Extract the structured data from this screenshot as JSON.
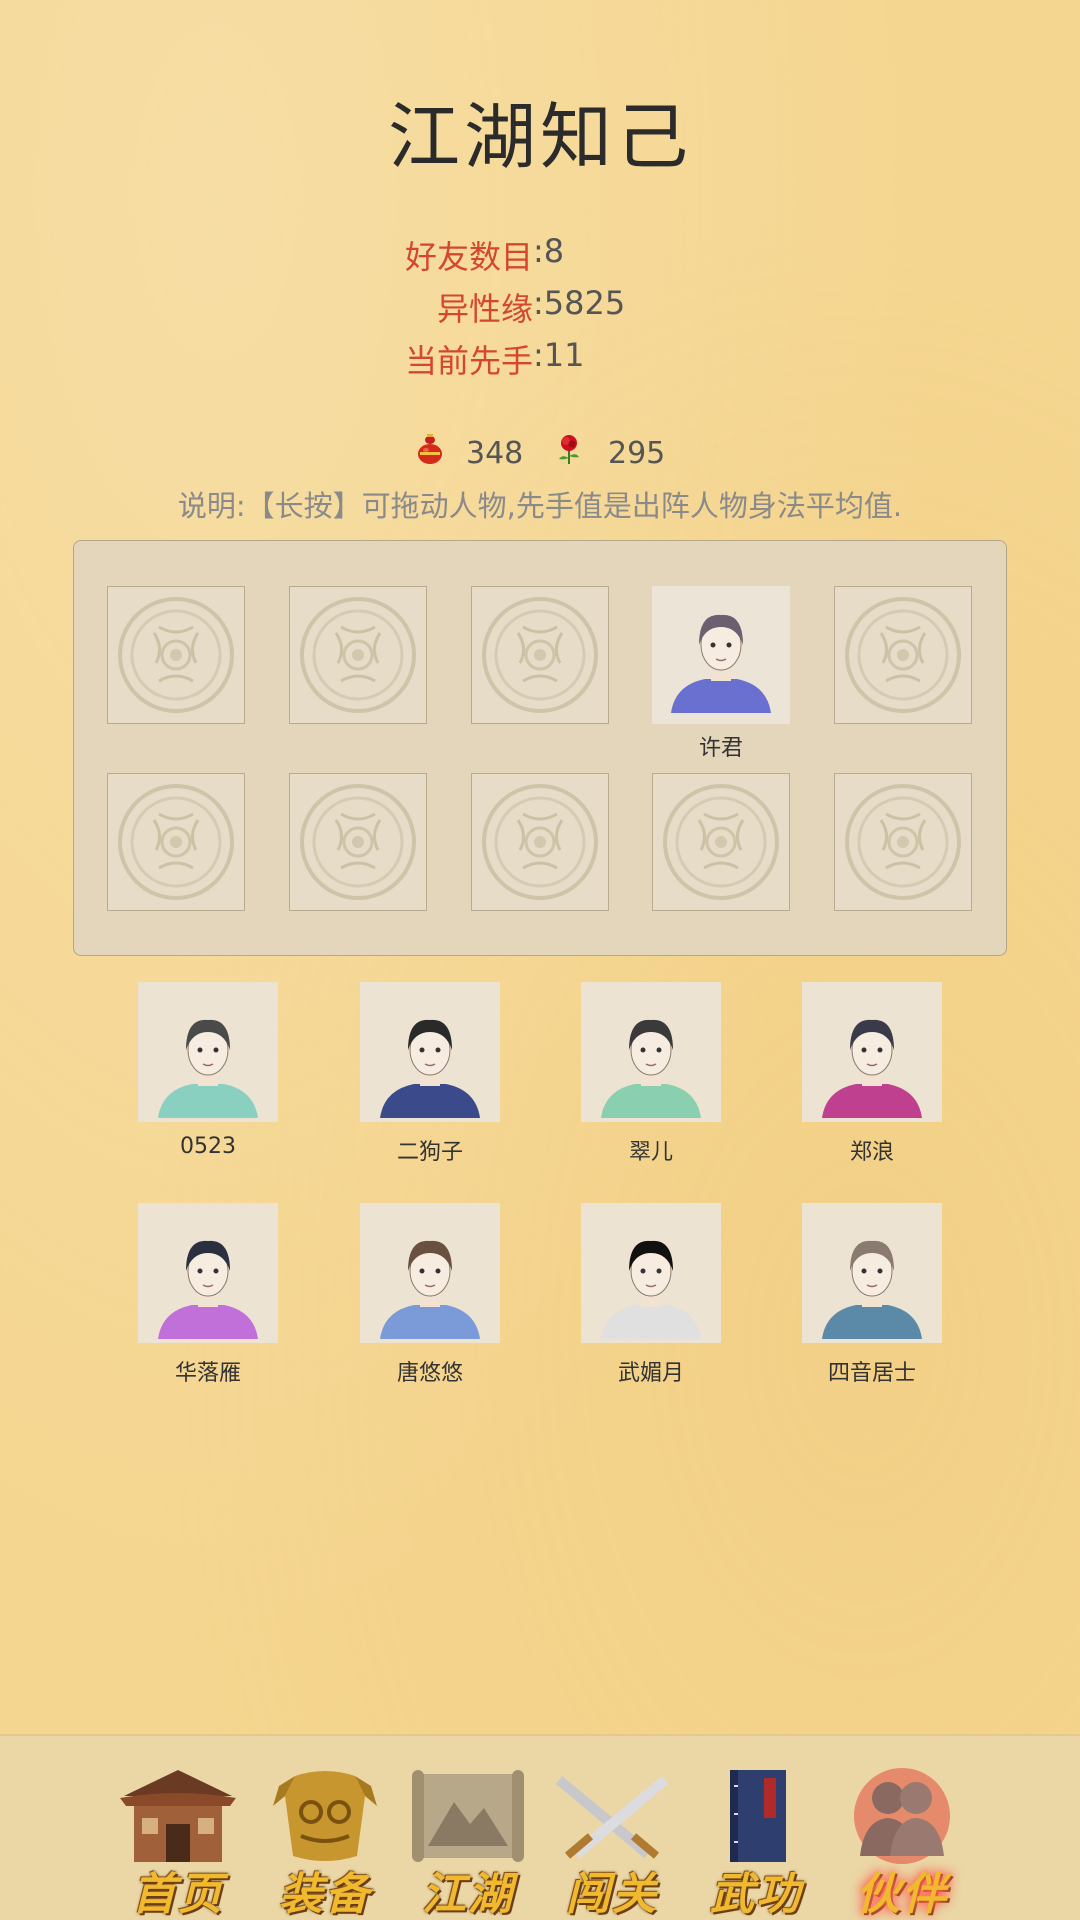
{
  "title": "江湖知己",
  "stats": [
    {
      "label": "好友数目",
      "value": ":8"
    },
    {
      "label": "异性缘",
      "value": ":5825"
    },
    {
      "label": "当前先手",
      "value": ":11"
    }
  ],
  "resources": [
    {
      "icon": "gourd-icon",
      "value": "348"
    },
    {
      "icon": "rose-icon",
      "value": "295"
    }
  ],
  "note": "说明:【长按】可拖动人物,先手值是出阵人物身法平均值.",
  "formation": {
    "occupied_slot": 3,
    "occupant_name": "许君",
    "empty_icon": "empty-slot-emblem-icon"
  },
  "roster": [
    {
      "name": "0523"
    },
    {
      "name": "二狗子"
    },
    {
      "name": "翠儿"
    },
    {
      "name": "郑浪"
    },
    {
      "name": "华落雁"
    },
    {
      "name": "唐悠悠"
    },
    {
      "name": "武媚月"
    },
    {
      "name": "四音居士"
    }
  ],
  "nav": [
    {
      "label": "首页",
      "icon": "house-icon"
    },
    {
      "label": "装备",
      "icon": "armor-icon"
    },
    {
      "label": "江湖",
      "icon": "scroll-map-icon"
    },
    {
      "label": "闯关",
      "icon": "crossed-swords-icon"
    },
    {
      "label": "武功",
      "icon": "book-icon"
    },
    {
      "label": "伙伴",
      "icon": "partners-icon",
      "active": true
    }
  ],
  "colors": {
    "background": "#f5d690",
    "label_red": "#d4472f",
    "nav_gold": "#f0b92e"
  }
}
